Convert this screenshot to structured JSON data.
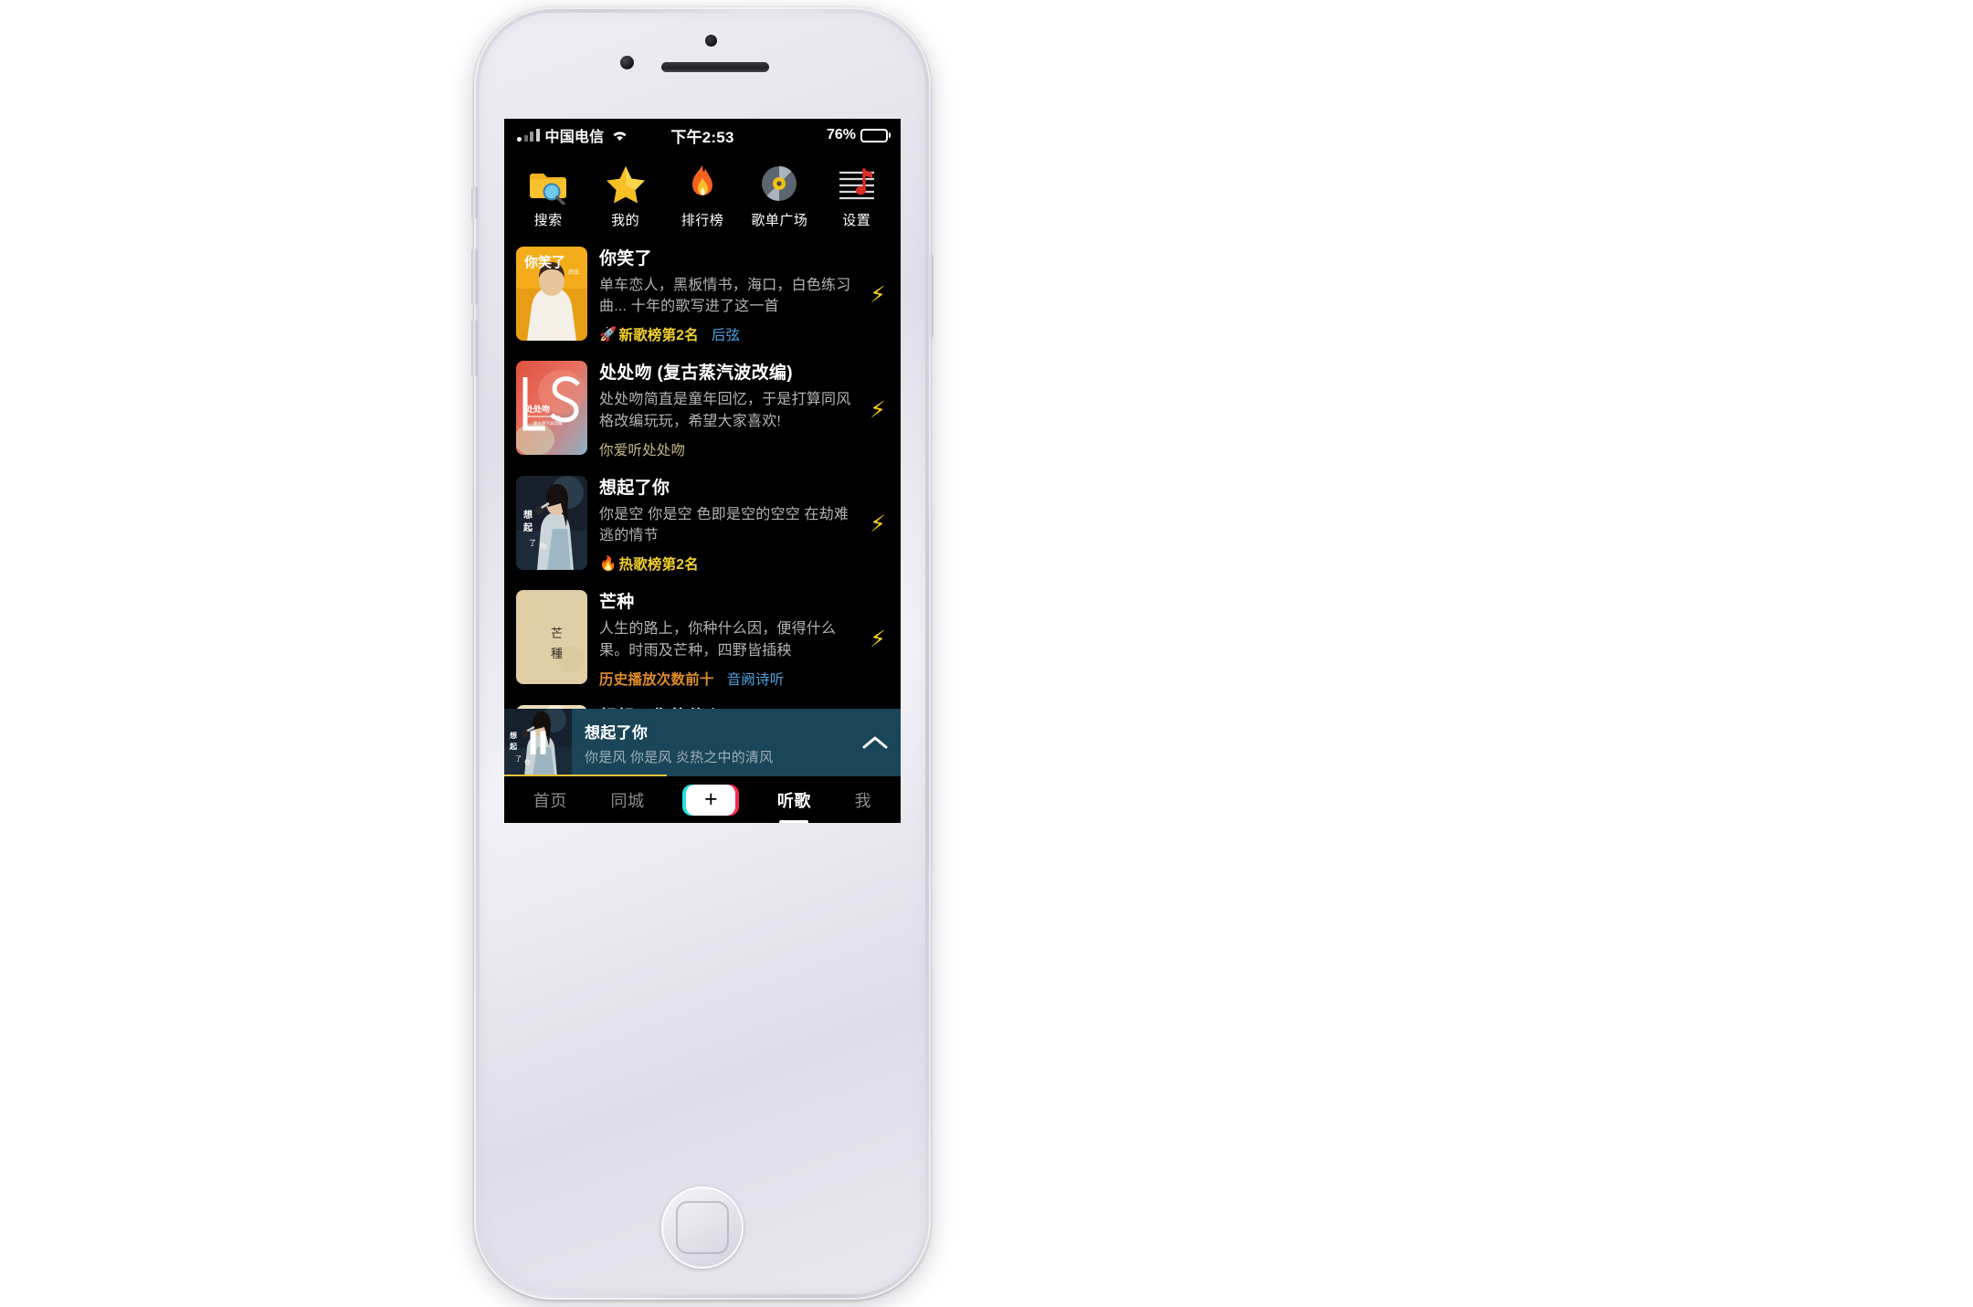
{
  "statusbar": {
    "carrier": "中国电信",
    "time": "下午2:53",
    "battery_percent": "76%",
    "wifi_icon": "wifi-icon",
    "signal_icon": "signal-bars-icon",
    "battery_icon": "battery-icon"
  },
  "topnav": {
    "items": [
      {
        "label": "搜索",
        "icon": "folder-search-icon"
      },
      {
        "label": "我的",
        "icon": "star-icon"
      },
      {
        "label": "排行榜",
        "icon": "fire-icon"
      },
      {
        "label": "歌单广场",
        "icon": "vinyl-record-icon"
      },
      {
        "label": "设置",
        "icon": "music-note-staff-icon"
      }
    ]
  },
  "songs": [
    {
      "title": "你笑了",
      "desc": "单车恋人，黑板情书，海口，白色练习曲... 十年的歌写进了这一首",
      "cover_title": "你笑了",
      "cover_kind": "yellow-portrait",
      "tags": [
        {
          "text": "新歌榜第2名",
          "emoji": "🚀",
          "color": "#f2d02c"
        },
        {
          "text": "后弦",
          "emoji": "",
          "color": "#4ea3e0"
        }
      ],
      "action_icon": "lightning-bolt-icon"
    },
    {
      "title": "处处吻 (复古蒸汽波改编)",
      "desc": "处处吻简直是童年回忆，于是打算同风格改编玩玩，希望大家喜欢!",
      "cover_title": "处处吻",
      "cover_kind": "pink-ls",
      "tags": [
        {
          "text": "你爱听处处吻",
          "emoji": "",
          "color": "#c8b888"
        }
      ],
      "action_icon": "lightning-bolt-icon"
    },
    {
      "title": "想起了你",
      "desc": "你是空 你是空 色即是空的空空 在劫难逃的情节",
      "cover_title": "想起了你",
      "cover_kind": "blue-singer",
      "tags": [
        {
          "text": "热歌榜第2名",
          "emoji": "🔥",
          "color": "#f2d02c"
        }
      ],
      "action_icon": "lightning-bolt-icon"
    },
    {
      "title": "芒种",
      "desc": "人生的路上，你种什么因，便得什么果。时雨及芒种，四野皆插秧",
      "cover_title": "芒種",
      "cover_kind": "beige-paper",
      "tags": [
        {
          "text": "历史播放次数前十",
          "emoji": "",
          "color": "#e08d2a"
        },
        {
          "text": "音阙诗听",
          "emoji": "",
          "color": "#4ea3e0"
        }
      ],
      "action_icon": "lightning-bolt-icon"
    },
    {
      "title": "想起了你的什么",
      "desc": "",
      "cover_title": "",
      "cover_kind": "beige-paper",
      "tags": [],
      "action_icon": "lightning-bolt-icon"
    }
  ],
  "miniplayer": {
    "title": "想起了你",
    "subtitle": "你是风 你是风 炎热之中的清风",
    "expand_icon": "chevron-up-icon",
    "state_icon": "pause-icon",
    "progress_percent": 41,
    "background_color": "#1b4558",
    "progress_color": "#e2c23a"
  },
  "tabbar": {
    "items": [
      {
        "label": "首页",
        "active": false
      },
      {
        "label": "同城",
        "active": false
      },
      {
        "label": "+",
        "active": false,
        "icon": "plus-icon"
      },
      {
        "label": "听歌",
        "active": true
      },
      {
        "label": "我",
        "active": false
      }
    ]
  }
}
